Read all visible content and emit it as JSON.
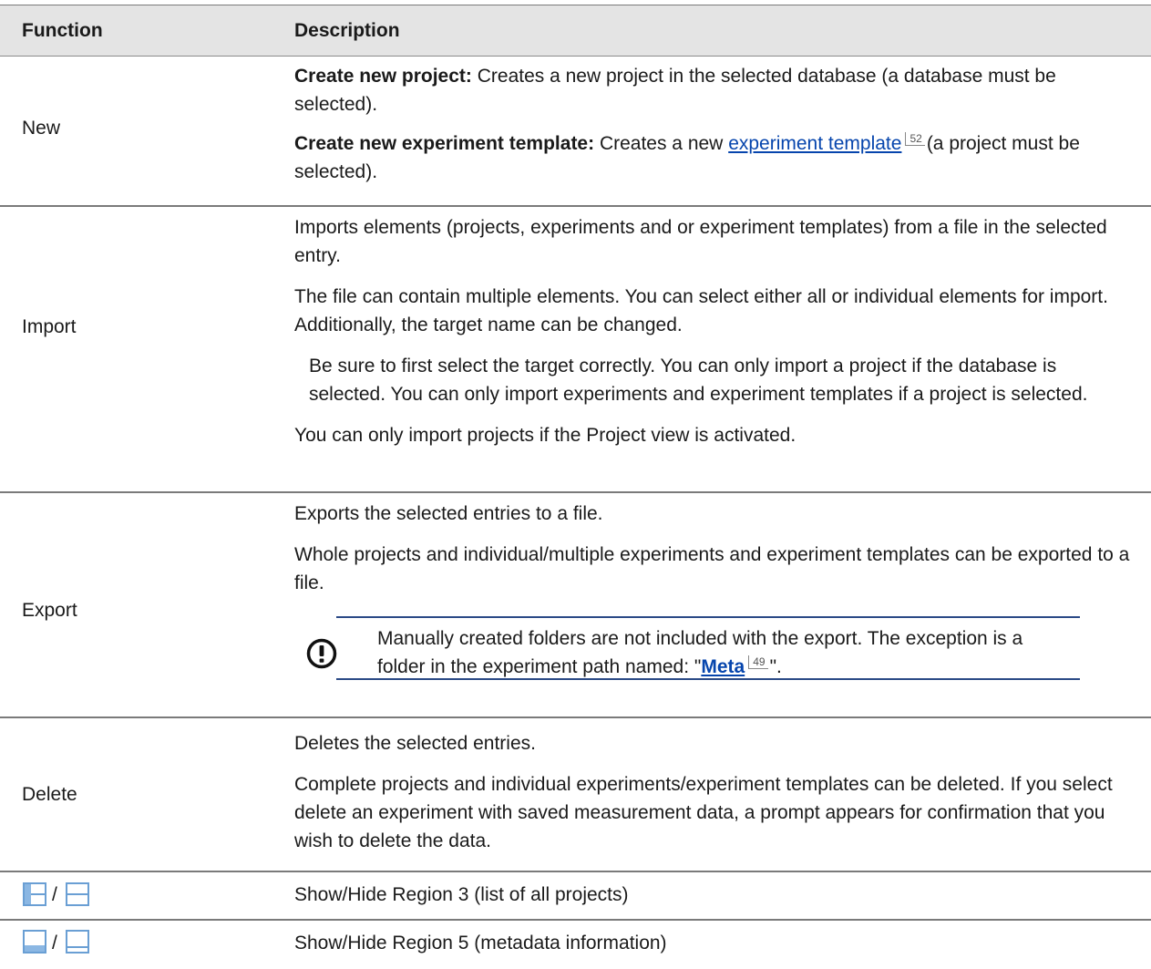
{
  "header": {
    "function": "Function",
    "description": "Description"
  },
  "rows": {
    "new": {
      "function": "New",
      "p1_bold": "Create new project:",
      "p1_text": " Creates a new project in the selected database (a database must be selected).",
      "p2_bold": "Create new experiment template:",
      "p2_pre": " Creates a new ",
      "p2_link": "experiment template",
      "p2_ref": "52",
      "p2_post": "(a project must be selected)."
    },
    "import": {
      "function": "Import",
      "p1": "Imports elements (projects, experiments and or experiment templates) from a file in the selected entry.",
      "p2": "The file can contain multiple elements. You can select either all or individual elements for import. Additionally, the target name can be changed.",
      "note": "Be sure to first select the target correctly. You can only import a project if the database is selected. You can only import experiments and experiment templates if a project is selected.",
      "p3": "You can only import projects if the Project view is activated."
    },
    "export": {
      "function": "Export",
      "p1": "Exports the selected entries to a file.",
      "p2": "Whole projects and individual/multiple experiments and experiment templates can be exported to a file.",
      "note_text": "Manually created folders are not included with the export. The exception is a folder in the experiment path named: \"",
      "note_link": "Meta",
      "note_ref": "49",
      "note_end": "\"."
    },
    "delete": {
      "function": "Delete",
      "p1": "Deletes the selected entries.",
      "p2": "Complete projects and individual experiments/experiment templates can be deleted. If you select delete an experiment with saved measurement data, a prompt appears for confirmation that you wish to delete the data."
    },
    "region3": {
      "separator": "/",
      "description": "Show/Hide Region 3 (list of all projects)"
    },
    "region5": {
      "separator": "/",
      "description": "Show/Hide Region 5 (metadata information)"
    }
  },
  "icons": {
    "warning": "exclamation-circle-icon",
    "region3_show": "panel-left-show-icon",
    "region3_hide": "panel-left-hide-icon",
    "region5_show": "panel-bottom-show-icon",
    "region5_hide": "panel-bottom-hide-icon"
  },
  "colors": {
    "header_bg": "#e4e4e4",
    "link": "#0645ad",
    "note_rule": "#2b4a86",
    "icon_blue": "#6a9fd4"
  }
}
